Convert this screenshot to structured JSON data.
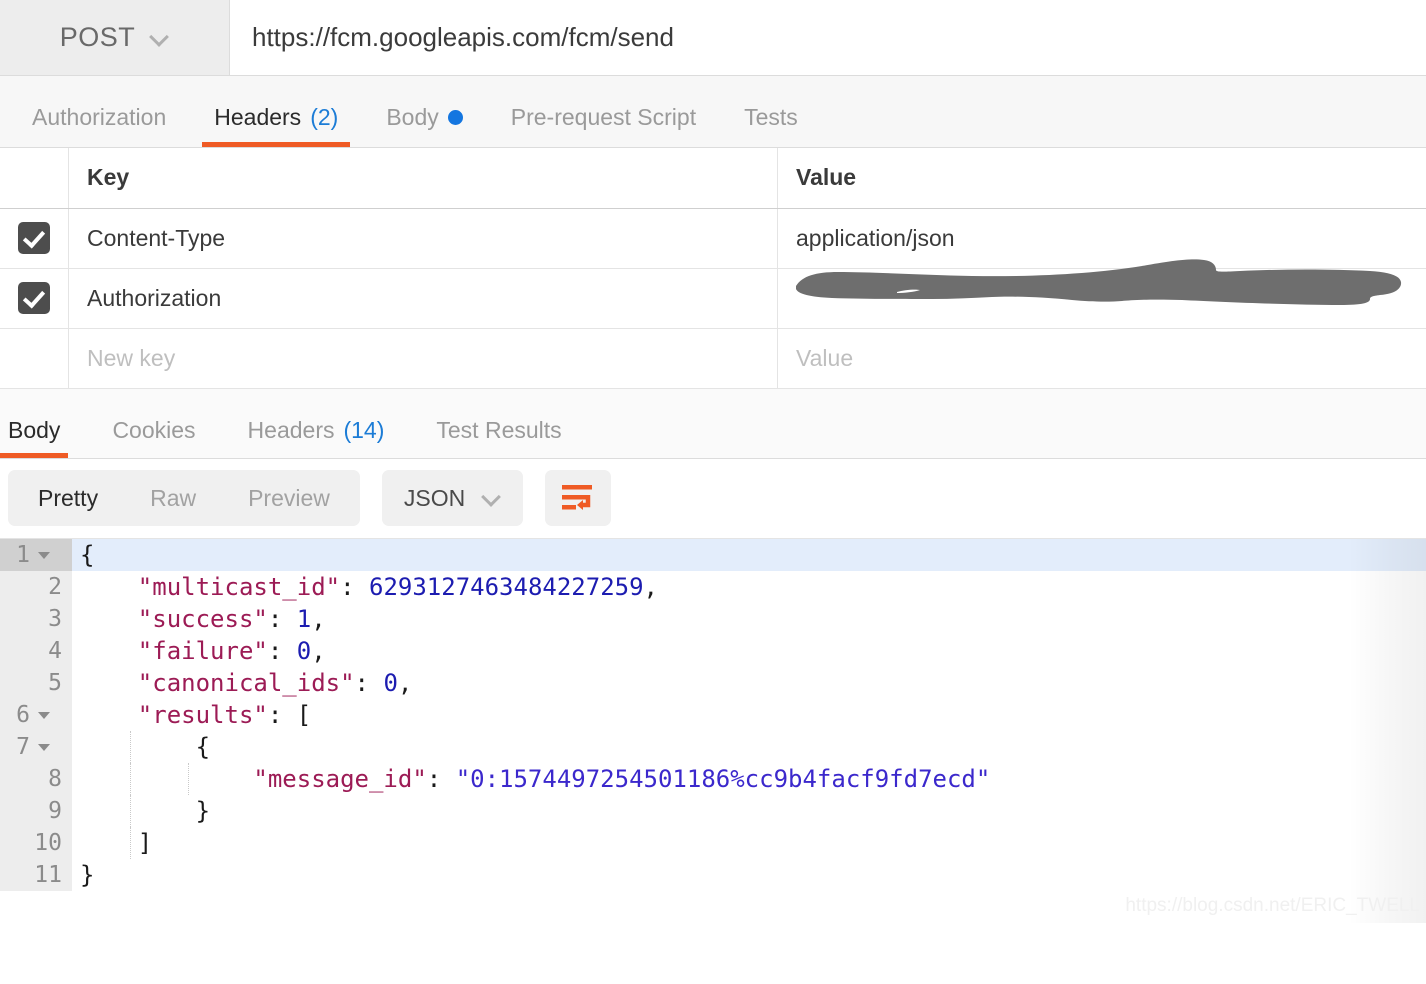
{
  "request": {
    "method": "POST",
    "url": "https://fcm.googleapis.com/fcm/send",
    "tabs": [
      {
        "label": "Authorization",
        "count": "",
        "active": false,
        "dot": false
      },
      {
        "label": "Headers",
        "count": "(2)",
        "active": true,
        "dot": false
      },
      {
        "label": "Body",
        "count": "",
        "active": false,
        "dot": true
      },
      {
        "label": "Pre-request Script",
        "count": "",
        "active": false,
        "dot": false
      },
      {
        "label": "Tests",
        "count": "",
        "active": false,
        "dot": false
      }
    ]
  },
  "headers_table": {
    "columns": [
      "Key",
      "Value"
    ],
    "rows": [
      {
        "checked": true,
        "key": "Content-Type",
        "value": "application/json",
        "redacted": false
      },
      {
        "checked": true,
        "key": "Authorization",
        "value": "",
        "redacted": true
      },
      {
        "checked": false,
        "key": "New key",
        "value": "Value",
        "placeholder": true
      }
    ]
  },
  "response": {
    "tabs": [
      {
        "label": "Body",
        "count": "",
        "active": true
      },
      {
        "label": "Cookies",
        "count": "",
        "active": false
      },
      {
        "label": "Headers",
        "count": "(14)",
        "active": false
      },
      {
        "label": "Test Results",
        "count": "",
        "active": false
      }
    ],
    "view_modes": [
      {
        "label": "Pretty",
        "active": true
      },
      {
        "label": "Raw",
        "active": false
      },
      {
        "label": "Preview",
        "active": false
      }
    ],
    "format": "JSON",
    "wrap_icon": "word-wrap-icon"
  },
  "code": {
    "lines": [
      {
        "n": "1",
        "fold": true,
        "active": true,
        "indent": 0,
        "guides": 0,
        "tokens": [
          {
            "t": "pnc",
            "v": "{"
          }
        ]
      },
      {
        "n": "2",
        "fold": false,
        "active": false,
        "indent": 1,
        "guides": 0,
        "tokens": [
          {
            "t": "k",
            "v": "\"multicast_id\""
          },
          {
            "t": "pnc",
            "v": ": "
          },
          {
            "t": "num",
            "v": "6293127463484227259"
          },
          {
            "t": "pnc",
            "v": ","
          }
        ]
      },
      {
        "n": "3",
        "fold": false,
        "active": false,
        "indent": 1,
        "guides": 0,
        "tokens": [
          {
            "t": "k",
            "v": "\"success\""
          },
          {
            "t": "pnc",
            "v": ": "
          },
          {
            "t": "num",
            "v": "1"
          },
          {
            "t": "pnc",
            "v": ","
          }
        ]
      },
      {
        "n": "4",
        "fold": false,
        "active": false,
        "indent": 1,
        "guides": 0,
        "tokens": [
          {
            "t": "k",
            "v": "\"failure\""
          },
          {
            "t": "pnc",
            "v": ": "
          },
          {
            "t": "num",
            "v": "0"
          },
          {
            "t": "pnc",
            "v": ","
          }
        ]
      },
      {
        "n": "5",
        "fold": false,
        "active": false,
        "indent": 1,
        "guides": 0,
        "tokens": [
          {
            "t": "k",
            "v": "\"canonical_ids\""
          },
          {
            "t": "pnc",
            "v": ": "
          },
          {
            "t": "num",
            "v": "0"
          },
          {
            "t": "pnc",
            "v": ","
          }
        ]
      },
      {
        "n": "6",
        "fold": true,
        "active": false,
        "indent": 1,
        "guides": 0,
        "tokens": [
          {
            "t": "k",
            "v": "\"results\""
          },
          {
            "t": "pnc",
            "v": ": ["
          }
        ]
      },
      {
        "n": "7",
        "fold": true,
        "active": false,
        "indent": 2,
        "guides": 1,
        "tokens": [
          {
            "t": "pnc",
            "v": "{"
          }
        ]
      },
      {
        "n": "8",
        "fold": false,
        "active": false,
        "indent": 3,
        "guides": 2,
        "tokens": [
          {
            "t": "k",
            "v": "\"message_id\""
          },
          {
            "t": "pnc",
            "v": ": "
          },
          {
            "t": "str",
            "v": "\"0:1574497254501186%cc9b4facf9fd7ecd\""
          }
        ]
      },
      {
        "n": "9",
        "fold": false,
        "active": false,
        "indent": 2,
        "guides": 1,
        "tokens": [
          {
            "t": "pnc",
            "v": "}"
          }
        ]
      },
      {
        "n": "10",
        "fold": false,
        "active": false,
        "indent": 1,
        "guides": 1,
        "tokens": [
          {
            "t": "pnc",
            "v": "]"
          }
        ]
      },
      {
        "n": "11",
        "fold": false,
        "active": false,
        "indent": 0,
        "guides": 0,
        "tokens": [
          {
            "t": "pnc",
            "v": "}"
          }
        ]
      }
    ]
  },
  "watermark": "https://blog.csdn.net/ERIC_TWELL",
  "colors": {
    "accent_orange": "#ef5b25",
    "link_blue": "#1c7cd6",
    "dot_blue": "#1476e0",
    "key_maroon": "#9c1b55",
    "number_blue": "#1c1cb0",
    "string_purple": "#3b28cc",
    "redaction_gray": "#6e6e6e"
  }
}
